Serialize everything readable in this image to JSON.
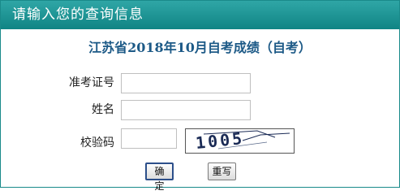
{
  "header": {
    "title": "请输入您的查询信息"
  },
  "exam": {
    "title": "江苏省2018年10月自考成绩（自考）"
  },
  "form": {
    "ticket": {
      "label": "准考证号",
      "value": ""
    },
    "name": {
      "label": "姓名",
      "value": ""
    },
    "captcha": {
      "label": "校验码",
      "value": "",
      "image_text": "1005"
    }
  },
  "actions": {
    "submit_label": "确定",
    "reset_label": "重写"
  }
}
